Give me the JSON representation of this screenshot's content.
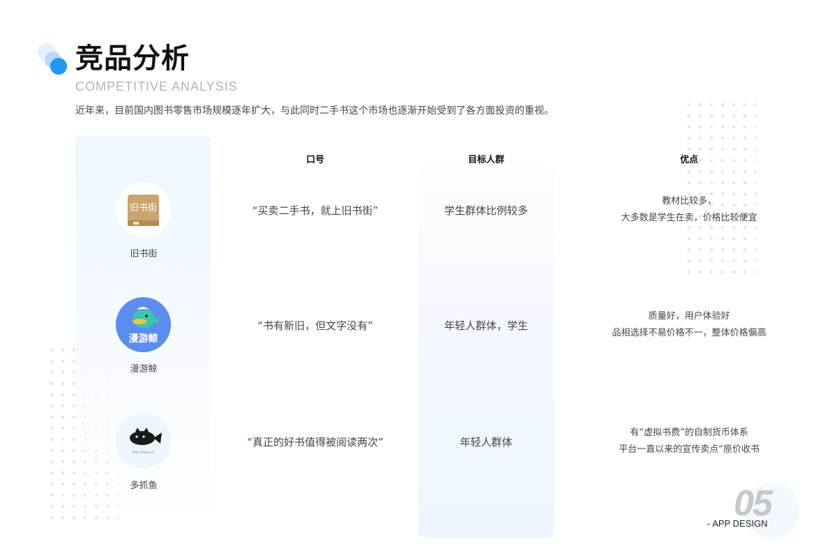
{
  "header": {
    "title": "竞品分析",
    "subtitle": "COMPETITIVE ANALYSIS",
    "intro": "近年来，目前国内图书零售市场规模逐年扩大，与此同时二手书这个市场也逐渐开始受到了各方面投资的重视。"
  },
  "table": {
    "columns": [
      "口号",
      "目标人群",
      "优点"
    ],
    "rows": [
      {
        "app": "旧书街",
        "logo_text": "旧书街",
        "logo_icon": "old-book-street-logo",
        "slogan": "“买卖二手书，就上旧书街”",
        "target": "学生群体比例较多",
        "advantages": [
          "教材比较多，",
          "大多数是学生在卖，价格比较便宜"
        ]
      },
      {
        "app": "漫游鲸",
        "logo_text": "漫游鲸",
        "logo_icon": "whale-logo",
        "slogan": "“书有新旧，但文字没有”",
        "target": "年轻人群体，学生",
        "advantages": [
          "质量好，用户体验好",
          "品相选择不易价格不一，整体价格偏高"
        ]
      },
      {
        "app": "多抓鱼",
        "logo_text": "duo zhua yu",
        "logo_icon": "fish-logo",
        "slogan": "“真正的好书值得被阅读两次”",
        "target": "年轻人群体",
        "advantages": [
          "有“虚拟书费”的自制货币体系",
          "平台一直以来的宣传卖点“原价收书"
        ]
      }
    ]
  },
  "footer": {
    "page_number": "05",
    "label": "- APP DESIGN"
  },
  "colors": {
    "accent": "#2196f3",
    "accent_light": "#b8d9f8",
    "panel": "#eff6ff",
    "whale_bg": "#5b8def",
    "old_book_logo": "#c9a46b"
  }
}
